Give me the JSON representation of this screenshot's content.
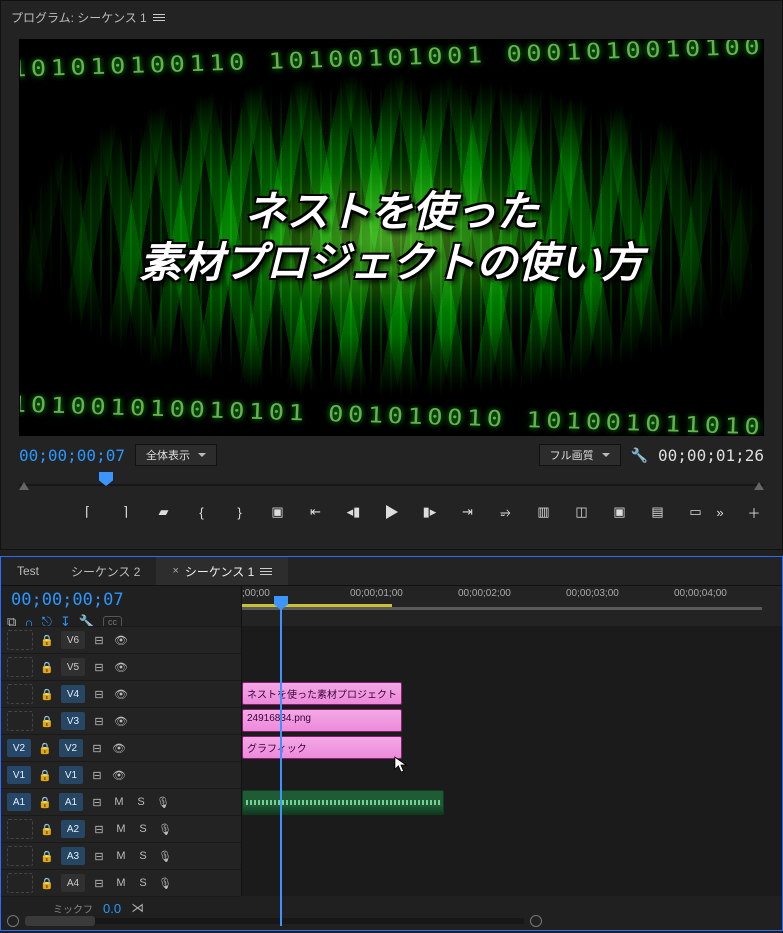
{
  "program": {
    "header": "プログラム: シーケンス 1",
    "overlay_line1": "ネストを使った",
    "overlay_line2": "素材プロジェクトの使い方",
    "timecode": "00;00;00;07",
    "zoom_label": "全体表示",
    "quality_label": "フル画質",
    "duration": "00;00;01;26"
  },
  "timeline": {
    "tabs": [
      {
        "label": "Test"
      },
      {
        "label": "シーケンス 2"
      },
      {
        "label": "シーケンス 1",
        "active": true
      }
    ],
    "timecode": "00;00;00;07",
    "ruler": [
      ";00;00",
      "00;00;01;00",
      "00;00;02;00",
      "00;00;03;00",
      "00;00;04;00"
    ],
    "video_tracks": [
      {
        "name": "V6"
      },
      {
        "name": "V5"
      },
      {
        "name": "V4"
      },
      {
        "name": "V3"
      },
      {
        "name": "V2"
      },
      {
        "name": "V1"
      }
    ],
    "audio_tracks": [
      {
        "name": "A1"
      },
      {
        "name": "A2"
      },
      {
        "name": "A3"
      },
      {
        "name": "A4"
      }
    ],
    "src_patches": {
      "v": [
        "V2",
        "V1"
      ],
      "a": [
        "A1"
      ]
    },
    "clips": {
      "v3": "ネストを使った素材プロジェクト",
      "v2": "24916834.png",
      "v1": "グラフィック"
    },
    "mix_label": "ミックフ",
    "mix_value": "0.0",
    "btn_m": "M",
    "btn_s": "S"
  }
}
